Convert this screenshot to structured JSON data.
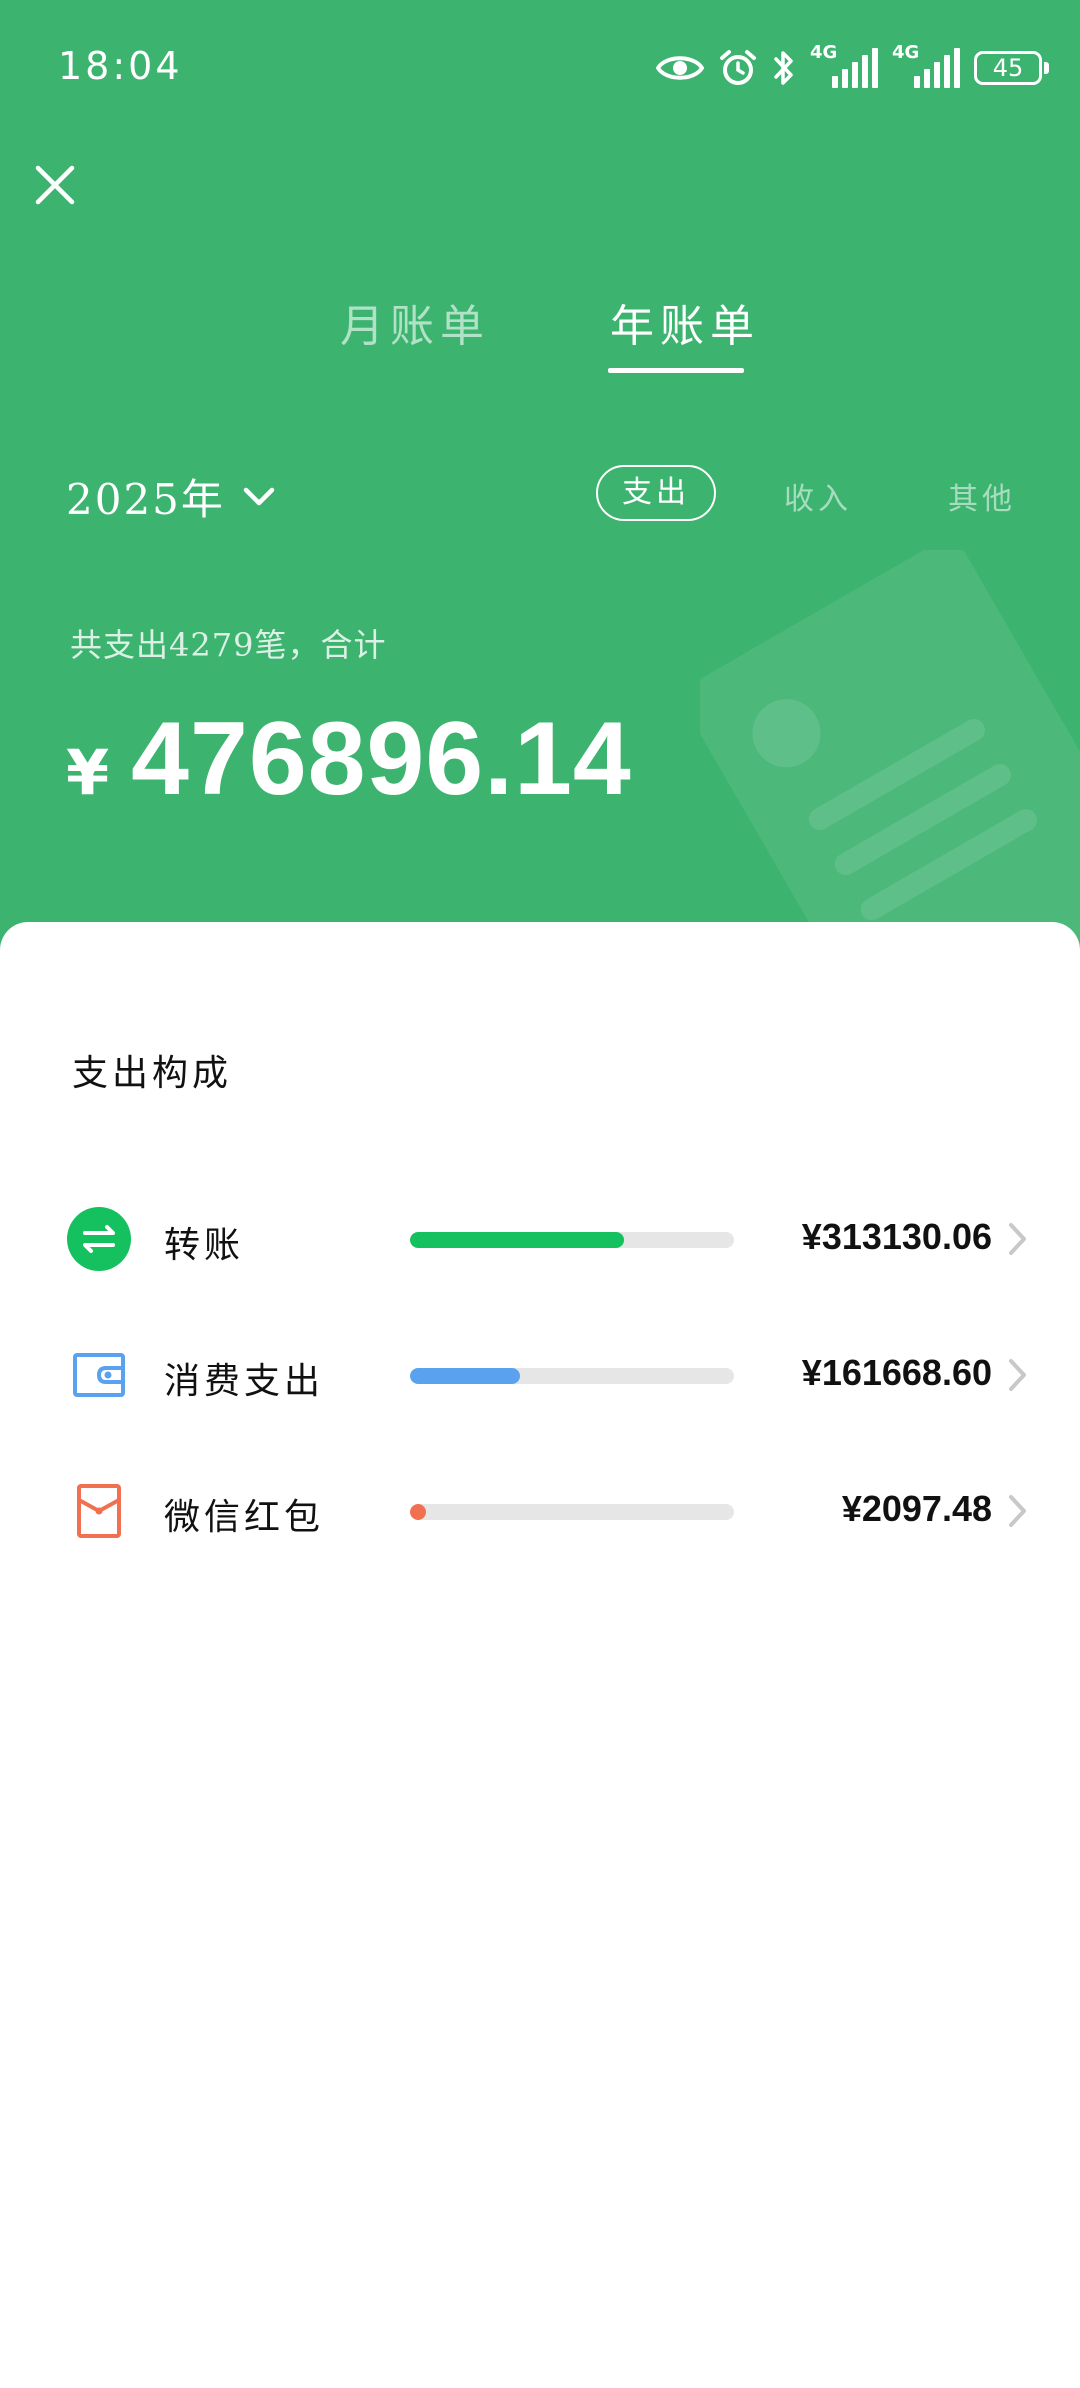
{
  "status_bar": {
    "time": "18:04",
    "battery": "45",
    "network_1": "4G",
    "network_2": "4G"
  },
  "tabs": [
    {
      "label": "月账单",
      "active": false
    },
    {
      "label": "年账单",
      "active": true
    }
  ],
  "year_selector": {
    "label": "2025年"
  },
  "filters": [
    {
      "label": "支出",
      "active": true
    },
    {
      "label": "收入",
      "active": false
    },
    {
      "label": "其他",
      "active": false
    }
  ],
  "summary": {
    "text": "共支出4279笔，合计",
    "currency": "¥",
    "total": "476896.14"
  },
  "breakdown": {
    "title": "支出构成",
    "items": [
      {
        "label": "转账",
        "amount": "¥313130.06",
        "fraction": 0.66,
        "color": "#14c15e",
        "icon": "transfer-icon"
      },
      {
        "label": "消费支出",
        "amount": "¥161668.60",
        "fraction": 0.34,
        "color": "#5aa1f0",
        "icon": "wallet-icon"
      },
      {
        "label": "微信红包",
        "amount": "¥2097.48",
        "fraction": 0.04,
        "color": "#f07050",
        "icon": "red-packet-icon"
      }
    ]
  },
  "colors": {
    "header_green": "#3db370",
    "transfer_green": "#14c15e",
    "wallet_blue": "#5aa1f0",
    "redpacket_orange": "#f07050"
  }
}
